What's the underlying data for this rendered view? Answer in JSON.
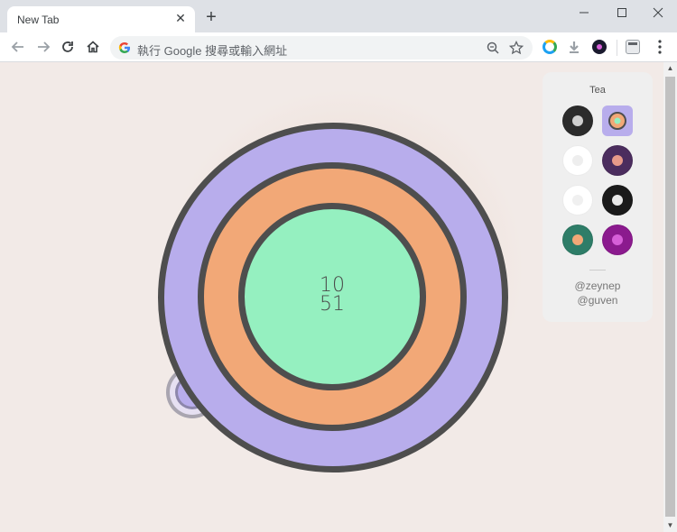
{
  "tab": {
    "title": "New Tab",
    "close_symbol": "✕"
  },
  "new_tab_symbol": "+",
  "omnibox": {
    "placeholder": "執行 Google 搜尋或輸入網址"
  },
  "timer": {
    "minutes": "10",
    "seconds": "51"
  },
  "panel": {
    "title": "Tea",
    "credits": [
      "@zeynep",
      "@guven"
    ],
    "swatches": [
      {
        "name": "dark",
        "outer": "#2b2b2b",
        "inner": "#cfcfcf",
        "selected": false
      },
      {
        "name": "tea",
        "outer": "#f2a877",
        "inner": "#95f0c0",
        "selected": true
      },
      {
        "name": "white",
        "outer": "#ffffff",
        "inner": "#eeeeee",
        "selected": false
      },
      {
        "name": "night",
        "outer": "#4b2d5e",
        "inner": "#e89a8a",
        "selected": false
      },
      {
        "name": "snow",
        "outer": "#ffffff",
        "inner": "#f0f0f0",
        "selected": false
      },
      {
        "name": "black",
        "outer": "#1a1a1a",
        "inner": "#e8e8e8",
        "selected": false
      },
      {
        "name": "forest",
        "outer": "#2e7d68",
        "inner": "#f2a877",
        "selected": false
      },
      {
        "name": "magenta",
        "outer": "#8b1a8e",
        "inner": "#d65fd8",
        "selected": false
      }
    ]
  },
  "colors": {
    "outer_ring": "#b8adec",
    "middle_ring": "#f2a877",
    "inner_ring": "#95f0c0",
    "ring_border": "#4e4e4e",
    "background": "#f2eae7"
  }
}
